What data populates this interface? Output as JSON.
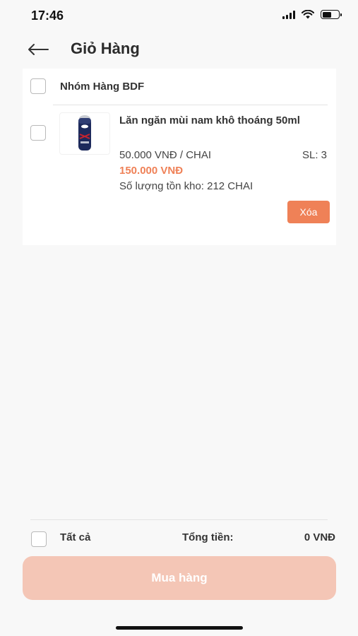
{
  "status_bar": {
    "time": "17:46",
    "icons": [
      "signal-icon",
      "wifi-icon",
      "battery-icon"
    ],
    "battery_level": 0.55
  },
  "header": {
    "back_icon": "arrow-left-icon",
    "title": "Giỏ Hàng"
  },
  "cart": {
    "group_name": "Nhóm Hàng BDF",
    "items": [
      {
        "name": "Lăn ngăn mùi nam khô thoáng 50ml",
        "unit_price": "50.000 VNĐ / CHAI",
        "quantity": "SL: 3",
        "total": "150.000 VNĐ",
        "stock": "Số lượng tồn kho: 212 CHAI",
        "delete_label": "Xóa",
        "image_icon": "deodorant-bottle-icon"
      }
    ]
  },
  "footer": {
    "select_all_label": "Tất cả",
    "total_label": "Tổng tiền:",
    "total_value": "0 VNĐ",
    "buy_label": "Mua hàng"
  },
  "colors": {
    "accent": "#ef8157",
    "buy_button_disabled": "#f4c6b6",
    "background": "#f8f8f8"
  }
}
